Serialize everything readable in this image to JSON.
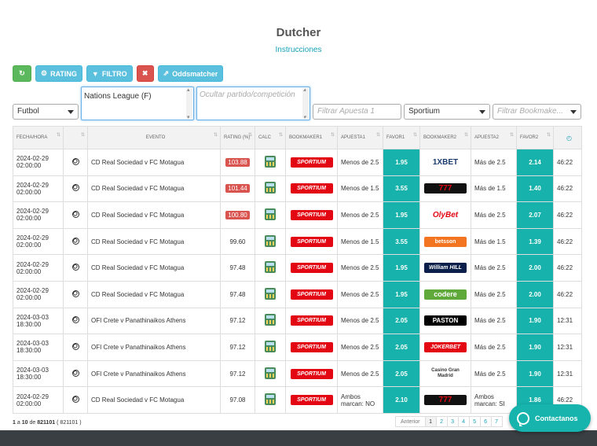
{
  "header": {
    "title": "Dutcher",
    "instructions_link": "Instrucciones"
  },
  "toolbar": {
    "refresh_icon": "↻",
    "rating_label": "RATING",
    "filter_label": "FILTRO",
    "clear_icon": "✖",
    "oddsmatcher_label": "Oddsmatcher"
  },
  "filters": {
    "sport_selected": "Futbol",
    "competition_selected": "Nations League (F)",
    "hide_placeholder": "Ocultar partido/competición",
    "bet1_placeholder": "Filtrar Apuesta 1",
    "bookmaker_selected": "Sportium",
    "bookmaker_placeholder": "Filtrar Bookmake..."
  },
  "table": {
    "headers": {
      "fecha": "FECHA/HORA",
      "evento": "EVENTO",
      "rating": "RATING (%)",
      "calc": "CALC",
      "bookmaker1": "BOOKMAKER1",
      "apuesta1": "APUESTA1",
      "favor1": "FAVOR1",
      "bookmaker2": "BOOKMAKER2",
      "apuesta2": "APUESTA2",
      "favor2": "FAVOR2",
      "clock_icon": "clock-icon"
    },
    "rows": [
      {
        "date": "2024-02-29",
        "time": "02:00:00",
        "event": "CD Real Sociedad v FC Motagua",
        "rating": "103.88",
        "rating_highlight": true,
        "bk1": "SPORTIUM",
        "bet1": "Menos de 2.5",
        "favor1": "1.95",
        "bk2": "1XBET",
        "bet2": "Más de 2.5",
        "favor2": "2.14",
        "timer": "46:22"
      },
      {
        "date": "2024-02-29",
        "time": "02:00:00",
        "event": "CD Real Sociedad v FC Motagua",
        "rating": "101.44",
        "rating_highlight": true,
        "bk1": "SPORTIUM",
        "bet1": "Menos de 1.5",
        "favor1": "3.55",
        "bk2": "777",
        "bet2": "Más de 1.5",
        "favor2": "1.40",
        "timer": "46:22"
      },
      {
        "date": "2024-02-29",
        "time": "02:00:00",
        "event": "CD Real Sociedad v FC Motagua",
        "rating": "100.80",
        "rating_highlight": true,
        "bk1": "SPORTIUM",
        "bet1": "Menos de 2.5",
        "favor1": "1.95",
        "bk2": "OlyBet",
        "bet2": "Más de 2.5",
        "favor2": "2.07",
        "timer": "46:22"
      },
      {
        "date": "2024-02-29",
        "time": "02:00:00",
        "event": "CD Real Sociedad v FC Motagua",
        "rating": "99.60",
        "rating_highlight": false,
        "bk1": "SPORTIUM",
        "bet1": "Menos de 1.5",
        "favor1": "3.55",
        "bk2": "betsson",
        "bet2": "Más de 1.5",
        "favor2": "1.39",
        "timer": "46:22"
      },
      {
        "date": "2024-02-29",
        "time": "02:00:00",
        "event": "CD Real Sociedad v FC Motagua",
        "rating": "97.48",
        "rating_highlight": false,
        "bk1": "SPORTIUM",
        "bet1": "Menos de 2.5",
        "favor1": "1.95",
        "bk2": "William HILL",
        "bet2": "Más de 2.5",
        "favor2": "2.00",
        "timer": "46:22"
      },
      {
        "date": "2024-02-29",
        "time": "02:00:00",
        "event": "CD Real Sociedad v FC Motagua",
        "rating": "97.48",
        "rating_highlight": false,
        "bk1": "SPORTIUM",
        "bet1": "Menos de 2.5",
        "favor1": "1.95",
        "bk2": "codere",
        "bet2": "Más de 2.5",
        "favor2": "2.00",
        "timer": "46:22"
      },
      {
        "date": "2024-03-03",
        "time": "18:30:00",
        "event": "OFI Crete v Panathinaikos Athens",
        "rating": "97.12",
        "rating_highlight": false,
        "bk1": "SPORTIUM",
        "bet1": "Menos de 2.5",
        "favor1": "2.05",
        "bk2": "PASTON",
        "bet2": "Más de 2.5",
        "favor2": "1.90",
        "timer": "12:31"
      },
      {
        "date": "2024-03-03",
        "time": "18:30:00",
        "event": "OFI Crete v Panathinaikos Athens",
        "rating": "97.12",
        "rating_highlight": false,
        "bk1": "SPORTIUM",
        "bet1": "Menos de 2.5",
        "favor1": "2.05",
        "bk2": "JOKERBET",
        "bet2": "Más de 2.5",
        "favor2": "1.90",
        "timer": "12:31"
      },
      {
        "date": "2024-03-03",
        "time": "18:30:00",
        "event": "OFI Crete v Panathinaikos Athens",
        "rating": "97.12",
        "rating_highlight": false,
        "bk1": "SPORTIUM",
        "bet1": "Menos de 2.5",
        "favor1": "2.05",
        "bk2": "Casino Gran Madrid",
        "bet2": "Más de 2.5",
        "favor2": "1.90",
        "timer": "12:31"
      },
      {
        "date": "2024-02-29",
        "time": "02:00:00",
        "event": "CD Real Sociedad v FC Motagua",
        "rating": "97.08",
        "rating_highlight": false,
        "bk1": "SPORTIUM",
        "bet1": "Ambos marcan: NO",
        "favor1": "2.10",
        "bk2": "777",
        "bet2": "Ambos marcan: SI",
        "favor2": "1.86",
        "timer": "46:22"
      }
    ]
  },
  "footer": {
    "range_from": "1",
    "range_sep_a": "a",
    "range_to": "10",
    "range_sep_de": "de",
    "total": "821101",
    "total_paren": "( 821101 )"
  },
  "pagination": {
    "prev": "Anterior",
    "pages": [
      "1",
      "2",
      "3",
      "4",
      "5",
      "6",
      "7"
    ],
    "active": "1"
  },
  "contact": {
    "label": "Contactanos"
  },
  "colors": {
    "accent": "#16b2ab",
    "link": "#17a2b8",
    "danger": "#d9534f"
  }
}
